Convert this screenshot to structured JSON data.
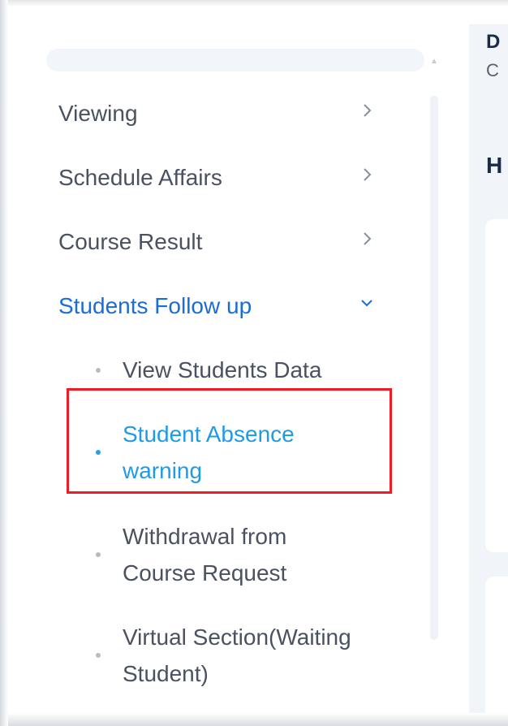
{
  "menu": {
    "items": [
      {
        "label": "Viewing",
        "expanded": false
      },
      {
        "label": "Schedule Affairs",
        "expanded": false
      },
      {
        "label": "Course Result",
        "expanded": false
      },
      {
        "label": "Students Follow up",
        "expanded": true
      }
    ],
    "submenu": {
      "items": [
        {
          "line1": "View Students Data",
          "line2": "",
          "active": false
        },
        {
          "line1": "Student Absence",
          "line2": "warning",
          "active": true
        },
        {
          "line1": "Withdrawal from",
          "line2": "Course Request",
          "active": false
        },
        {
          "line1": "Virtual Section(Waiting",
          "line2": "Student)",
          "active": false
        }
      ]
    }
  },
  "right_panel": {
    "text1": "D",
    "text2": "C",
    "text3": "H"
  },
  "colors": {
    "active_menu": "#1a6dd6",
    "active_submenu": "#1f9be6",
    "highlight_border": "#ee1c24",
    "default_text": "#4a5160"
  },
  "icons": {
    "collapsed": "chevron-right-icon",
    "expanded": "chevron-down-icon",
    "bullet": "dot-icon",
    "scroll_up": "arrow-up-icon"
  }
}
